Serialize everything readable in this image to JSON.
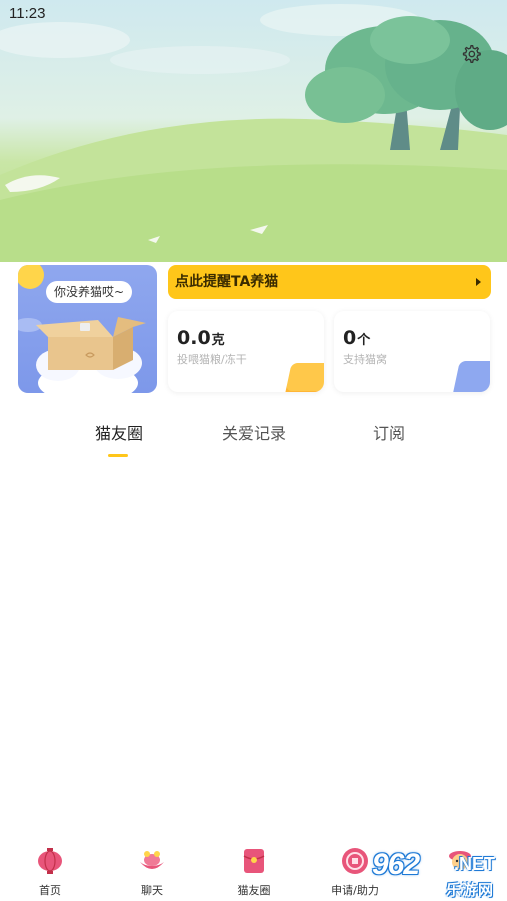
{
  "status_bar": {
    "time": "11:23"
  },
  "header": {
    "settings_icon": "gear-icon"
  },
  "cat_card": {
    "speech": "你没养猫哎~"
  },
  "remind_banner": {
    "label": "点此提醒TA养猫",
    "accent": "#ffc61a"
  },
  "stats": {
    "food": {
      "value": "0.0",
      "unit": "克",
      "caption": "投喂猫粮/冻干"
    },
    "support": {
      "value": "0",
      "unit": "个",
      "caption": "支持猫窝"
    }
  },
  "tabs": [
    {
      "label": "猫友圈",
      "active": true
    },
    {
      "label": "关爱记录",
      "active": false
    },
    {
      "label": "订阅",
      "active": false
    }
  ],
  "bottom_nav": [
    {
      "label": "首页",
      "icon": "lantern-icon"
    },
    {
      "label": "聊天",
      "icon": "ingot-icon"
    },
    {
      "label": "猫友圈",
      "icon": "red-envelope-icon"
    },
    {
      "label": "申请/助力",
      "icon": "coin-icon"
    },
    {
      "label": "",
      "icon": "mascot-icon"
    }
  ],
  "watermark": {
    "number": "962",
    "suffix": ".NET",
    "cn": "乐游网"
  }
}
